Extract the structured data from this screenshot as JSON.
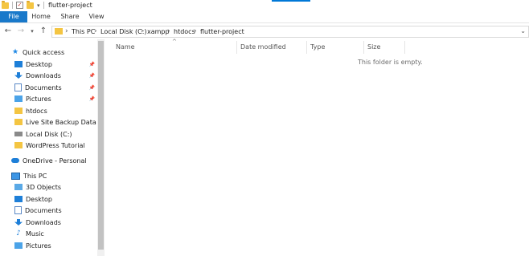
{
  "window": {
    "title": "flutter-project"
  },
  "ribbon": {
    "tabs": [
      "File",
      "Home",
      "Share",
      "View"
    ]
  },
  "address": {
    "crumbs": [
      "This PC",
      "Local Disk (C:)",
      "xampp",
      "htdocs",
      "flutter-project"
    ]
  },
  "sidebar": {
    "quick_access": "Quick access",
    "items": [
      {
        "label": "Desktop",
        "icon": "desktop-icon",
        "pinned": true
      },
      {
        "label": "Downloads",
        "icon": "download-icon",
        "pinned": true
      },
      {
        "label": "Documents",
        "icon": "documents-icon",
        "pinned": true
      },
      {
        "label": "Pictures",
        "icon": "pictures-icon",
        "pinned": true
      },
      {
        "label": "htdocs",
        "icon": "folder-icon",
        "pinned": false
      },
      {
        "label": "Live Site Backup Data",
        "icon": "folder-icon",
        "pinned": false
      },
      {
        "label": "Local Disk (C:)",
        "icon": "disk-icon",
        "pinned": false
      },
      {
        "label": "WordPress Tutorial",
        "icon": "folder-icon",
        "pinned": false
      }
    ],
    "onedrive": "OneDrive - Personal",
    "this_pc": "This PC",
    "pc_items": [
      {
        "label": "3D Objects",
        "icon": "3d-objects-icon"
      },
      {
        "label": "Desktop",
        "icon": "desktop-icon"
      },
      {
        "label": "Documents",
        "icon": "documents-icon"
      },
      {
        "label": "Downloads",
        "icon": "download-icon"
      },
      {
        "label": "Music",
        "icon": "music-icon"
      },
      {
        "label": "Pictures",
        "icon": "pictures-icon"
      }
    ]
  },
  "content": {
    "columns": [
      "Name",
      "Date modified",
      "Type",
      "Size"
    ],
    "empty_message": "This folder is empty."
  },
  "colors": {
    "accent": "#1979ca",
    "folder": "#f4c542"
  }
}
